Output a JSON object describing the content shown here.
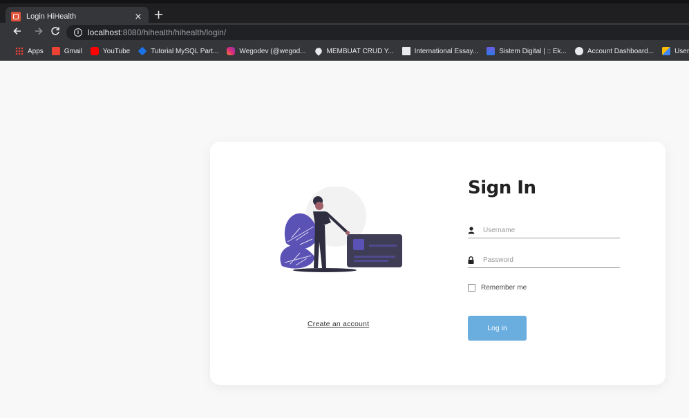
{
  "browser": {
    "tab_title": "Login HiHealth",
    "tab_close": "×",
    "new_tab": "+",
    "url_host": "localhost",
    "url_rest": ":8080/hihealth/hihealth/login/",
    "icons": {
      "back": "arrow-left-icon",
      "forward": "arrow-right-icon",
      "reload": "reload-icon",
      "info": "info-icon"
    }
  },
  "bookmarks": [
    {
      "label": "Apps",
      "icon": "apps-grid-icon"
    },
    {
      "label": "Gmail",
      "icon": "gmail-icon"
    },
    {
      "label": "YouTube",
      "icon": "youtube-icon"
    },
    {
      "label": "Tutorial MySQL Part...",
      "icon": "tutorial-icon"
    },
    {
      "label": "Wegodev (@wegod...",
      "icon": "instagram-icon"
    },
    {
      "label": "MEMBUAT CRUD Y...",
      "icon": "pin-icon"
    },
    {
      "label": "International Essay...",
      "icon": "document-icon"
    },
    {
      "label": "Sistem Digital | :: Ek...",
      "icon": "sistem-icon"
    },
    {
      "label": "Account Dashboard...",
      "icon": "globe-icon"
    },
    {
      "label": "User I",
      "icon": "user-icon"
    }
  ],
  "login": {
    "title": "Sign In",
    "username_placeholder": "Username",
    "password_placeholder": "Password",
    "remember_label": "Remember me",
    "login_button": "Log in",
    "create_account": "Create an account"
  },
  "colors": {
    "accent": "#6aaee0",
    "illustration_purple": "#5b52b6",
    "card_dark": "#3f3d56"
  }
}
